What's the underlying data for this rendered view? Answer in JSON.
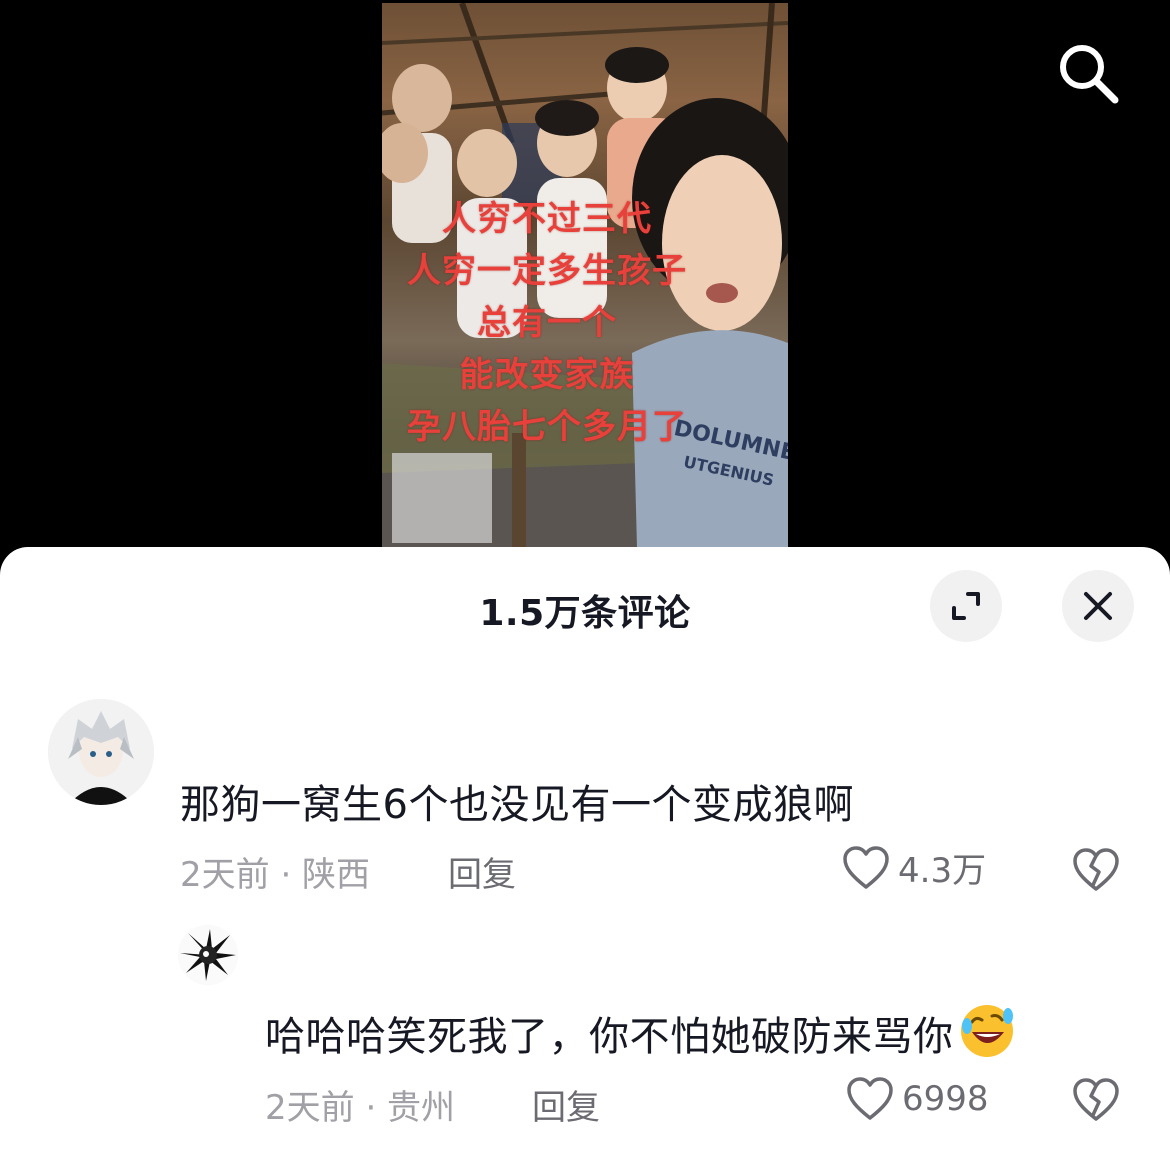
{
  "video": {
    "caption_lines": [
      "人穷不过三代",
      "人穷一定多生孩子",
      "总有一个",
      "能改变家族",
      "孕八胎七个多月了"
    ],
    "shirt_text": [
      "DOLUMNELLOW",
      "UTGENIUS"
    ],
    "search_icon": "search-icon"
  },
  "comments_sheet": {
    "title": "1.5万条评论",
    "expand_icon": "expand-icon",
    "close_icon": "close-icon",
    "comments": [
      {
        "text": "那狗一窝生6个也没见有一个变成狼啊",
        "meta": "2天前 · 陕西",
        "reply_label": "回复",
        "like_count": "4.3万",
        "avatar_icon": "anime-avatar"
      },
      {
        "text": "哈哈哈笑死我了，你不怕她破防来骂你",
        "emoji": "rolling-on-floor-laughing-emoji",
        "meta": "2天前 · 贵州",
        "reply_label": "回复",
        "like_count": "6998",
        "avatar_icon": "splash-avatar"
      }
    ]
  },
  "colors": {
    "caption_red": "#e8403a",
    "text_primary": "#161823",
    "text_secondary": "#a0a0a6",
    "sheet_bg": "#ffffff",
    "button_bg": "#f1f1f2"
  }
}
